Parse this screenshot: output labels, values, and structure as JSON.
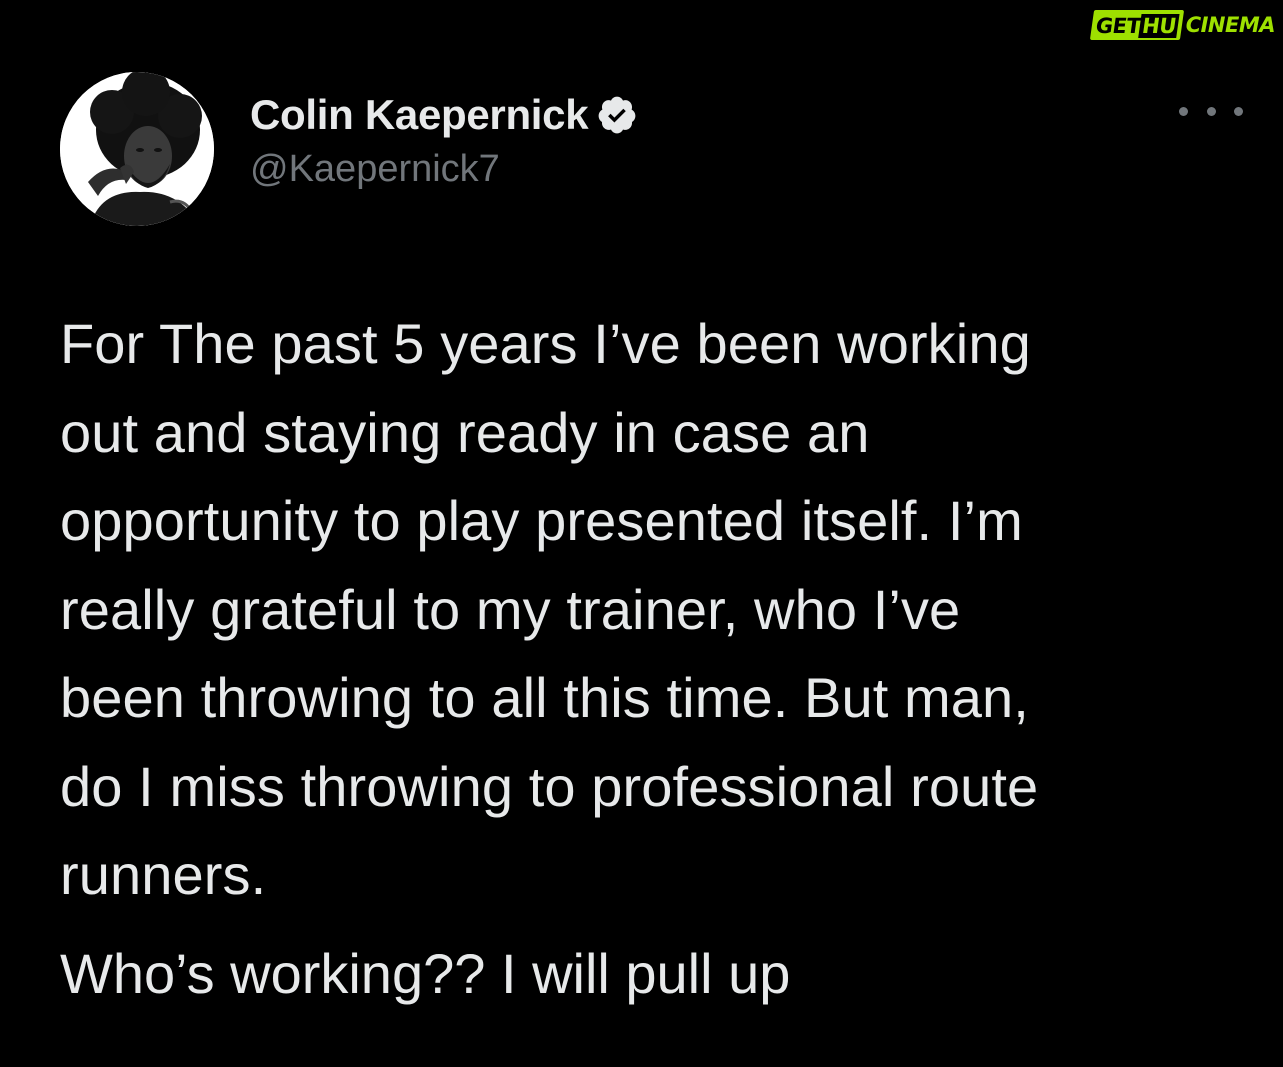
{
  "watermark": {
    "part1_a": "GET",
    "part1_b": "HU",
    "part2": "CINEMA"
  },
  "tweet": {
    "author": {
      "display_name": "Colin Kaepernick",
      "handle": "@Kaepernick7",
      "verified": true,
      "avatar_icon": "profile-photo"
    },
    "more_icon": "ellipsis-icon",
    "body_paragraph_1": "For The past 5 years I’ve been working\nout and staying ready in case an\nopportunity to play presented itself. I’m\nreally grateful to my trainer, who I’ve\nbeen throwing to all this time. But man,\ndo I miss throwing to professional route\nrunners.",
    "body_paragraph_2": "Who’s working?? I will pull up"
  },
  "colors": {
    "background": "#000000",
    "text_primary": "#e7e9ea",
    "text_secondary": "#71767b",
    "watermark_green": "#9ee000"
  }
}
